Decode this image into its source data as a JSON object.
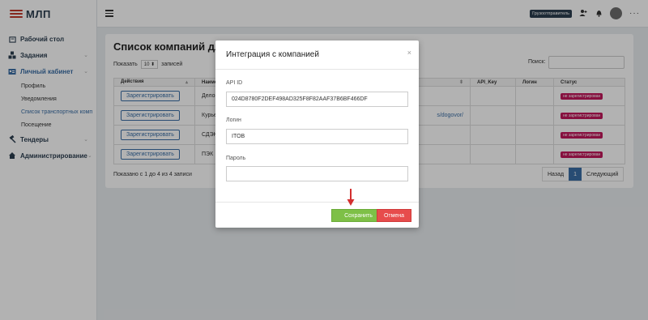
{
  "app": {
    "logo_text": "МЛП"
  },
  "topbar": {
    "role_badge": "Грузоотправитель"
  },
  "sidebar": {
    "items": [
      {
        "label": "Рабочий стол"
      },
      {
        "label": "Задания"
      },
      {
        "label": "Личный кабинет"
      },
      {
        "label": "Тендеры"
      },
      {
        "label": "Администрирование"
      }
    ],
    "sub_items": [
      {
        "label": "Профиль"
      },
      {
        "label": "Уведомления"
      },
      {
        "label": "Список транспортных комп"
      },
      {
        "label": "Посещение"
      }
    ]
  },
  "main": {
    "title": "Список компаний для",
    "show_label": "Показать",
    "page_size": "10",
    "entries_label": "записей",
    "search_label": "Поиск:",
    "table": {
      "columns": [
        "Действия",
        "Наимен",
        "",
        "API_Key",
        "Логин",
        "Статус"
      ],
      "rows": [
        {
          "action": "Зарегистрировать",
          "name": "Делов",
          "link": "",
          "status": "не зарегистрирован"
        },
        {
          "action": "Зарегистрировать",
          "name": "Курье",
          "link": "s/dogovor/",
          "status": "не зарегистрирован"
        },
        {
          "action": "Зарегистрировать",
          "name": "СДЭК",
          "link": "",
          "status": "не зарегистрирован"
        },
        {
          "action": "Зарегистрировать",
          "name": "ПЭК",
          "link": "",
          "status": "не зарегистрирован"
        }
      ]
    },
    "info": "Показано с 1 до 4 из 4 записи",
    "pager": {
      "prev": "Назад",
      "current": "1",
      "next": "Следующий"
    }
  },
  "modal": {
    "title": "Интеграция с компанией",
    "close_glyph": "×",
    "api_id_label": "API ID",
    "api_id_value": "024D8780F2DEF498AD325F8F82AAF37B6BF466DF",
    "login_label": "Логин",
    "login_value": "ITOB",
    "password_label": "Пароль",
    "password_value": "",
    "save_label": "Сохранить",
    "cancel_label": "Отмена"
  },
  "colors": {
    "accent": "#3a6ea5",
    "save": "#7ec047",
    "cancel": "#e74c4c",
    "status": "#c2185b",
    "arrow": "#d32f2f"
  }
}
